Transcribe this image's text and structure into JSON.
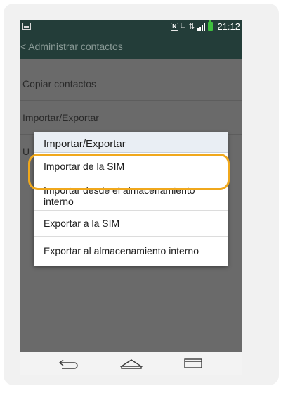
{
  "status_bar": {
    "time": "21:12",
    "icons": [
      "image-icon",
      "nfc-icon",
      "vibrate-icon",
      "data-icon",
      "signal-icon",
      "battery-icon"
    ]
  },
  "app_bar": {
    "title": "Administrar contactos",
    "back_icon": "chevron-left-icon"
  },
  "list": {
    "items": [
      {
        "label": "Copiar contactos"
      },
      {
        "label": "Importar/Exportar"
      },
      {
        "label": "U"
      }
    ]
  },
  "dialog": {
    "title": "Importar/Exportar",
    "options": [
      {
        "label": "Importar de la SIM",
        "highlighted": true
      },
      {
        "label": "Importar desde el almacenamiento interno"
      },
      {
        "label": "Exportar a la SIM"
      },
      {
        "label": "Exportar al almacenamiento interno"
      }
    ]
  },
  "nav_bar": {
    "buttons": [
      "back-icon",
      "home-icon",
      "recents-icon"
    ]
  },
  "colors": {
    "app_bar": "#233d39",
    "highlight": "#f0a81c",
    "battery": "#3fbf3f"
  }
}
